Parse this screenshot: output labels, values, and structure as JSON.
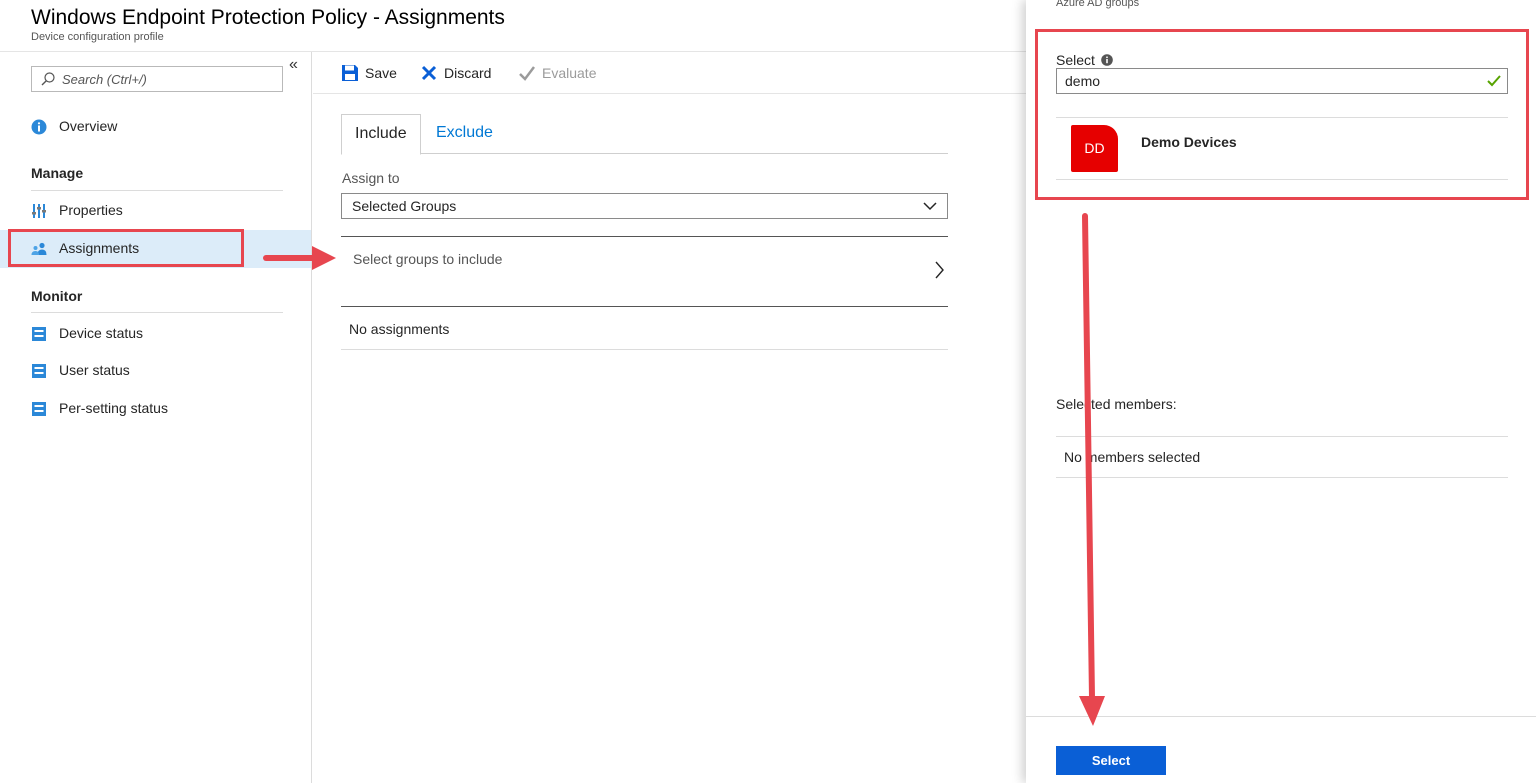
{
  "header": {
    "title": "Windows Endpoint Protection Policy - Assignments",
    "subtitle": "Device configuration profile"
  },
  "sidebar": {
    "search_placeholder": "Search (Ctrl+/)",
    "collapse_glyph": "«",
    "overview": "Overview",
    "manage_heading": "Manage",
    "properties": "Properties",
    "assignments": "Assignments",
    "monitor_heading": "Monitor",
    "device_status": "Device status",
    "user_status": "User status",
    "per_setting_status": "Per-setting status"
  },
  "toolbar": {
    "save": "Save",
    "discard": "Discard",
    "evaluate": "Evaluate"
  },
  "main": {
    "tab_include": "Include",
    "tab_exclude": "Exclude",
    "assign_to_label": "Assign to",
    "assign_to_value": "Selected Groups",
    "select_groups": "Select groups to include",
    "no_assignments": "No assignments"
  },
  "blade": {
    "breadcrumb": "Azure AD groups",
    "select_label": "Select",
    "search_value": "demo",
    "result_initials": "DD",
    "result_name": "Demo Devices",
    "selected_members_label": "Selected members:",
    "no_members": "No members selected",
    "select_button": "Select"
  },
  "colors": {
    "accent_blue": "#0078d4",
    "select_button": "#0a5fd6",
    "avatar_red": "#e60000",
    "highlight_red": "#e7464f",
    "active_nav": "#dcecf9"
  },
  "icons": {
    "overview": "info-icon",
    "properties": "sliders-icon",
    "assignments": "users-icon",
    "status": "report-icon",
    "save": "floppy-disk-icon",
    "discard": "x-icon",
    "evaluate": "checkmark-icon"
  }
}
